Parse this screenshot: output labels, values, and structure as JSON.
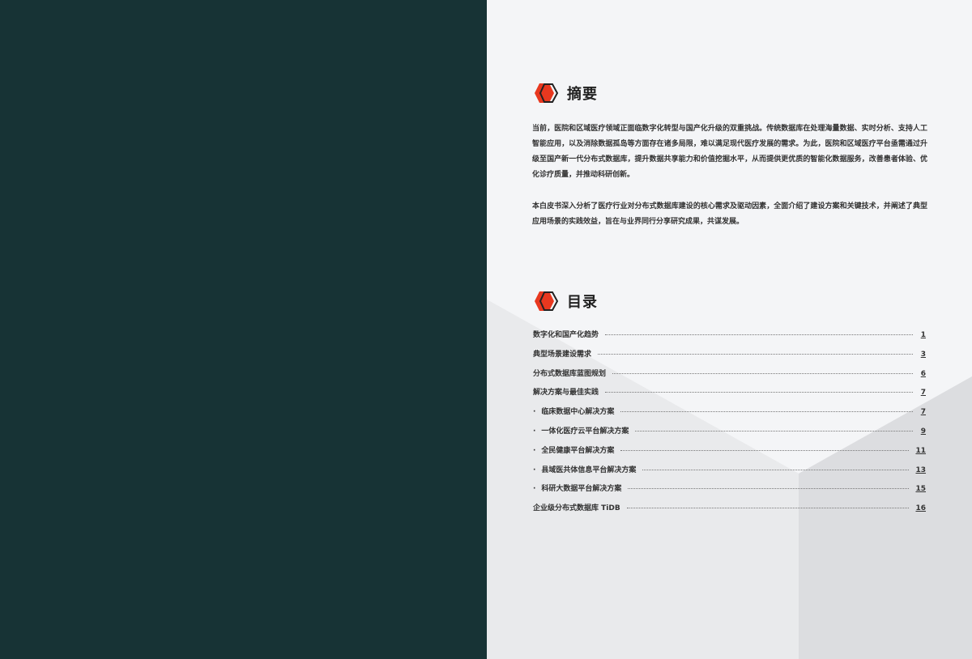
{
  "summary": {
    "heading": "摘要",
    "paragraphs": [
      "当前，医院和区域医疗领域正面临数字化转型与国产化升级的双重挑战。传统数据库在处理海量数据、实时分析、支持人工智能应用，以及消除数据孤岛等方面存在诸多局限，难以满足现代医疗发展的需求。为此，医院和区域医疗平台亟需通过升级至国产新一代分布式数据库，提升数据共享能力和价值挖掘水平，从而提供更优质的智能化数据服务，改善患者体验、优化诊疗质量，并推动科研创新。",
      "本白皮书深入分析了医疗行业对分布式数据库建设的核心需求及驱动因素，全面介绍了建设方案和关键技术，并阐述了典型应用场景的实践效益，旨在与业界同行分享研究成果，共谋发展。"
    ]
  },
  "toc": {
    "heading": "目录",
    "items": [
      {
        "label": "数字化和国产化趋势",
        "page": "1",
        "sub": false
      },
      {
        "label": "典型场景建设需求",
        "page": "3",
        "sub": false
      },
      {
        "label": "分布式数据库蓝图规划",
        "page": "6",
        "sub": false
      },
      {
        "label": "解决方案与最佳实践",
        "page": "7",
        "sub": false
      },
      {
        "label": "临床数据中心解决方案",
        "page": "7",
        "sub": true
      },
      {
        "label": "一体化医疗云平台解决方案",
        "page": "9",
        "sub": true
      },
      {
        "label": "全民健康平台解决方案",
        "page": "11",
        "sub": true
      },
      {
        "label": "县域医共体信息平台解决方案",
        "page": "13",
        "sub": true
      },
      {
        "label": "科研大数据平台解决方案",
        "page": "15",
        "sub": true
      },
      {
        "label": "企业级分布式数据库 TiDB",
        "page": "16",
        "sub": false
      }
    ]
  },
  "colors": {
    "left_panel": "#173335",
    "right_panel": "#f4f5f7",
    "accent_red": "#e8381f"
  }
}
